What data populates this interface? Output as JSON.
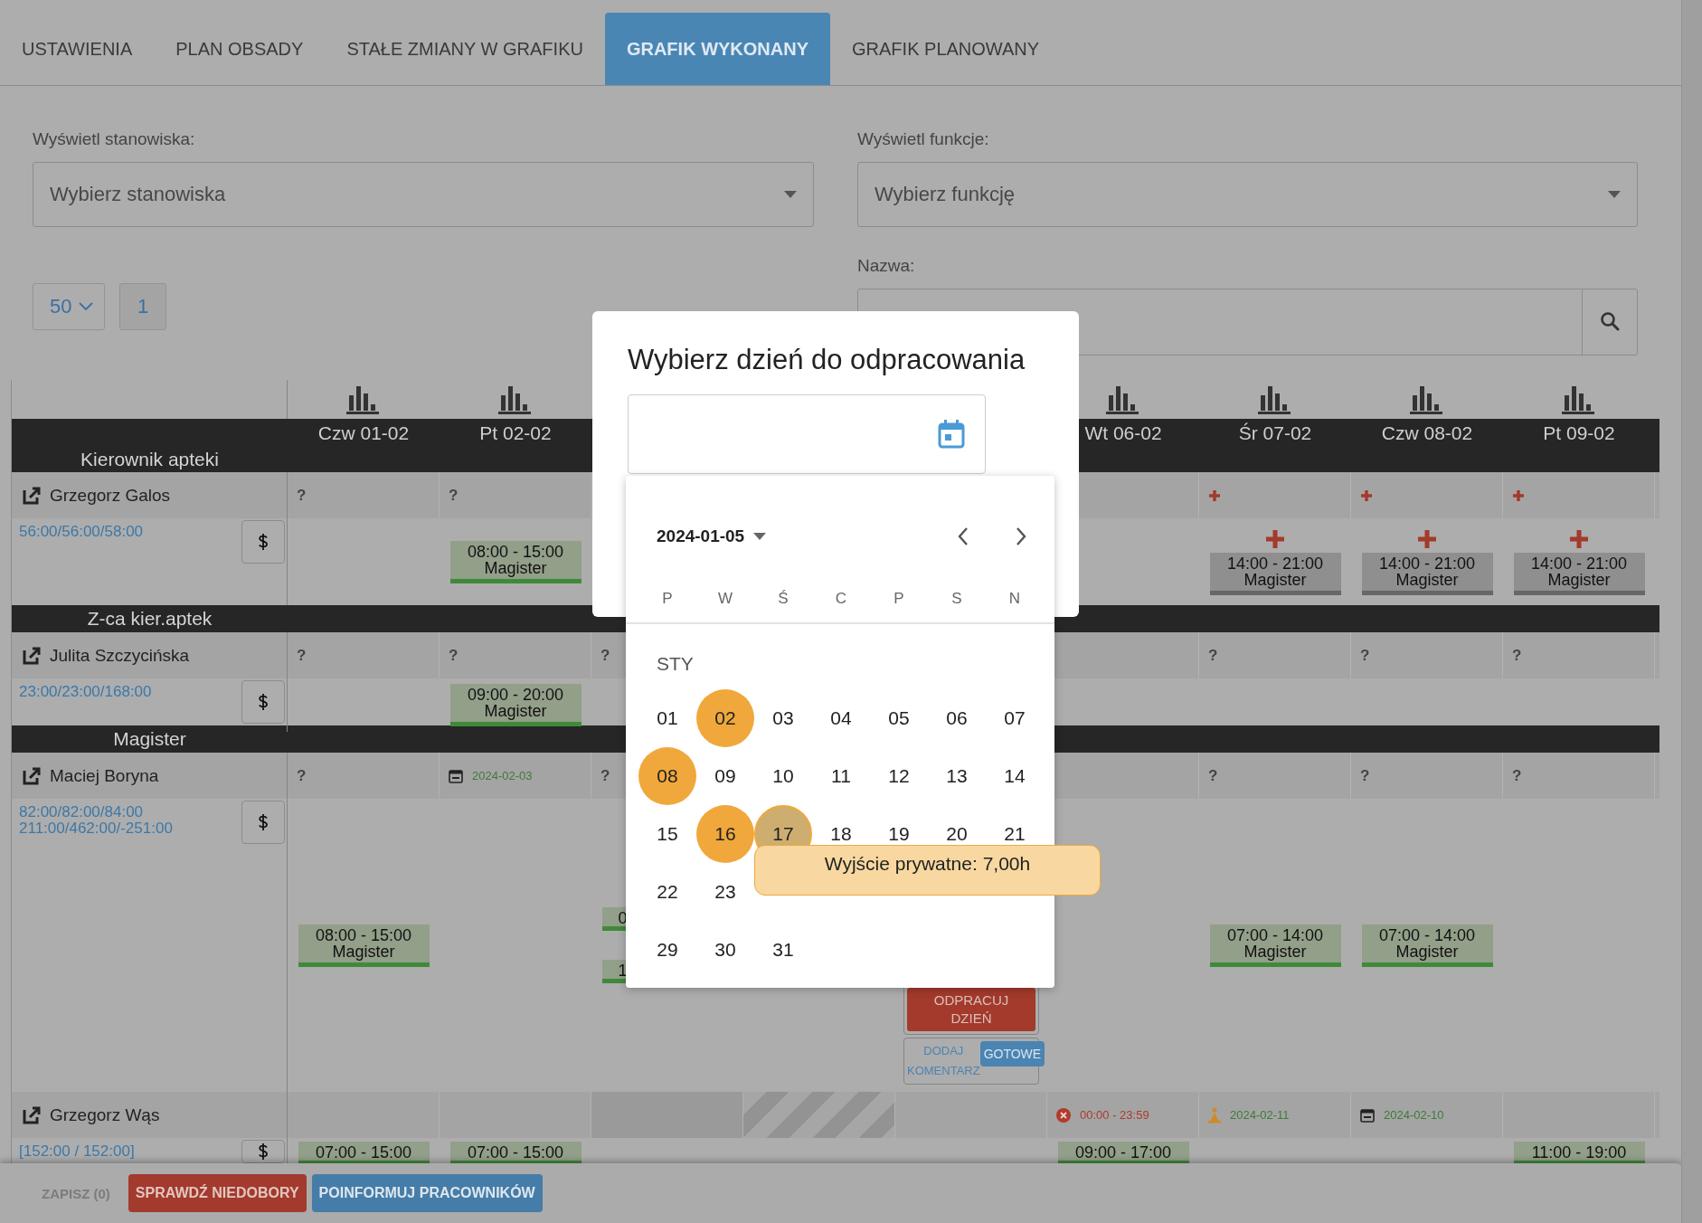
{
  "tabs": [
    {
      "label": "USTAWIENIA",
      "selected": false
    },
    {
      "label": "PLAN OBSADY",
      "selected": false
    },
    {
      "label": "STAŁE ZMIANY W GRAFIKU",
      "selected": false
    },
    {
      "label": "GRAFIK WYKONANY",
      "selected": true
    },
    {
      "label": "GRAFIK PLANOWANY",
      "selected": false
    }
  ],
  "filters": {
    "positions": {
      "label": "Wyświetl stanowiska:",
      "placeholder": "Wybierz stanowiska"
    },
    "functions": {
      "label": "Wyświetl funkcje:",
      "placeholder": "Wybierz funkcję"
    },
    "name": {
      "label": "Nazwa:"
    }
  },
  "page_size": "50",
  "pages": [
    "1"
  ],
  "days": [
    {
      "kind": "day",
      "label": "Czw 01-02"
    },
    {
      "kind": "day",
      "label": "Pt 02-02"
    },
    {
      "kind": "covered"
    },
    {
      "kind": "covered"
    },
    {
      "kind": "covered"
    },
    {
      "kind": "day",
      "label": "Wt 06-02"
    },
    {
      "kind": "day",
      "label": "Śr 07-02"
    },
    {
      "kind": "day",
      "label": "Czw 08-02"
    },
    {
      "kind": "day",
      "label": "Pt 09-02"
    }
  ],
  "groups": [
    {
      "name": "Kierownik apteki",
      "employees": [
        {
          "name": "Grzegorz Galos",
          "hours": [
            "56:00/56:00/58:00"
          ],
          "top": [
            {
              "kind": "note",
              "text": "?"
            },
            {
              "kind": "note",
              "text": "?"
            },
            {
              "kind": "empty"
            },
            {
              "kind": "empty"
            },
            {
              "kind": "empty"
            },
            {
              "kind": "empty"
            },
            {
              "kind": "add"
            },
            {
              "kind": "add"
            },
            {
              "kind": "add"
            }
          ],
          "body": [
            {
              "kind": "empty"
            },
            {
              "kind": "shifts",
              "add": false,
              "shifts": [
                {
                  "time": "08:00 - 15:00",
                  "role": "Magister",
                  "done": true,
                  "partial": false
                }
              ]
            },
            {
              "kind": "empty"
            },
            {
              "kind": "empty"
            },
            {
              "kind": "empty"
            },
            {
              "kind": "empty"
            },
            {
              "kind": "shifts",
              "add": true,
              "shifts": [
                {
                  "time": "14:00 - 21:00",
                  "role": "Magister",
                  "done": false,
                  "partial": false
                }
              ]
            },
            {
              "kind": "shifts",
              "add": true,
              "shifts": [
                {
                  "time": "14:00 - 21:00",
                  "role": "Magister",
                  "done": false,
                  "partial": false
                }
              ]
            },
            {
              "kind": "shifts",
              "add": true,
              "shifts": [
                {
                  "time": "14:00 - 21:00",
                  "role": "Magister",
                  "done": false,
                  "partial": false
                }
              ]
            }
          ]
        }
      ]
    },
    {
      "name": "Z-ca kier.aptek",
      "employees": [
        {
          "name": "Julita Szczycińska",
          "hours": [
            "23:00/23:00/168:00"
          ],
          "top": [
            {
              "kind": "note",
              "text": "?"
            },
            {
              "kind": "note",
              "text": "?"
            },
            {
              "kind": "note",
              "text": "?"
            },
            {
              "kind": "empty"
            },
            {
              "kind": "empty"
            },
            {
              "kind": "empty"
            },
            {
              "kind": "note",
              "text": "?"
            },
            {
              "kind": "note",
              "text": "?"
            },
            {
              "kind": "note",
              "text": "?"
            }
          ],
          "body": [
            {
              "kind": "empty"
            },
            {
              "kind": "shifts",
              "add": false,
              "shifts": [
                {
                  "time": "09:00 - 20:00",
                  "role": "Magister",
                  "done": true,
                  "partial": false
                }
              ]
            },
            {
              "kind": "empty"
            },
            {
              "kind": "empty"
            },
            {
              "kind": "empty"
            },
            {
              "kind": "empty"
            },
            {
              "kind": "empty"
            },
            {
              "kind": "empty"
            },
            {
              "kind": "empty"
            }
          ]
        }
      ]
    },
    {
      "name": "Magister",
      "employees": [
        {
          "name": "Maciej Boryna",
          "hours": [
            "82:00/82:00/84:00",
            "211:00/462:00/-251:00"
          ],
          "top": [
            {
              "kind": "note",
              "text": "?"
            },
            {
              "kind": "weekend",
              "text": "2024-02-03"
            },
            {
              "kind": "note",
              "text": "?"
            },
            {
              "kind": "empty"
            },
            {
              "kind": "empty"
            },
            {
              "kind": "empty"
            },
            {
              "kind": "note",
              "text": "?"
            },
            {
              "kind": "note",
              "text": "?"
            },
            {
              "kind": "note",
              "text": "?"
            }
          ],
          "body": [
            {
              "kind": "shifts",
              "add": false,
              "shifts": [
                {
                  "time": "08:00 - 15:00",
                  "role": "Magister",
                  "done": true,
                  "partial": false
                }
              ]
            },
            {
              "kind": "empty"
            },
            {
              "kind": "shifts",
              "add": false,
              "shifts": [
                {
                  "time": "0",
                  "done": true,
                  "partial": true
                },
                {
                  "time": "1",
                  "done": true,
                  "partial": true
                }
              ]
            },
            {
              "kind": "empty"
            },
            {
              "kind": "actions",
              "work_off": "ODPRACUJ DZIEŃ",
              "comment": "DODAJ KOMENTARZ",
              "done_label": "GOTOWE"
            },
            {
              "kind": "empty"
            },
            {
              "kind": "shifts",
              "add": false,
              "shifts": [
                {
                  "time": "07:00 - 14:00",
                  "role": "Magister",
                  "done": true,
                  "partial": false
                }
              ]
            },
            {
              "kind": "shifts",
              "add": false,
              "shifts": [
                {
                  "time": "07:00 - 14:00",
                  "role": "Magister",
                  "done": true,
                  "partial": false
                }
              ]
            },
            {
              "kind": "empty"
            }
          ]
        },
        {
          "name": "Grzegorz Wąs",
          "hours": [
            "[152:00 / 152:00]"
          ],
          "top": [
            {
              "kind": "empty"
            },
            {
              "kind": "empty"
            },
            {
              "kind": "blocked"
            },
            {
              "kind": "striped"
            },
            {
              "kind": "empty"
            },
            {
              "kind": "absence",
              "text": "00:00 - 23:59"
            },
            {
              "kind": "holiday",
              "text": "2024-02-11"
            },
            {
              "kind": "weekend",
              "text": "2024-02-10"
            },
            {
              "kind": "empty"
            }
          ],
          "body": [
            {
              "kind": "shifts",
              "add": false,
              "shifts": [
                {
                  "time": "07:00 - 15:00",
                  "done": true,
                  "partial": false
                }
              ]
            },
            {
              "kind": "shifts",
              "add": false,
              "shifts": [
                {
                  "time": "07:00 - 15:00",
                  "done": true,
                  "partial": false
                }
              ]
            },
            {
              "kind": "empty"
            },
            {
              "kind": "empty"
            },
            {
              "kind": "empty"
            },
            {
              "kind": "shifts",
              "add": false,
              "shifts": [
                {
                  "time": "09:00 - 17:00",
                  "done": true,
                  "partial": false
                }
              ]
            },
            {
              "kind": "empty"
            },
            {
              "kind": "empty"
            },
            {
              "kind": "shifts",
              "add": false,
              "shifts": [
                {
                  "time": "11:00 - 19:00",
                  "done": true,
                  "partial": false
                }
              ]
            }
          ]
        }
      ]
    }
  ],
  "bottom_bar": {
    "save": "ZAPISZ (0)",
    "check": "SPRAWDŹ NIEDOBORY",
    "inform": "POINFORMUJ PRACOWNIKÓW"
  },
  "modal": {
    "title": "Wybierz dzień do odpracowania",
    "datepicker": {
      "current": "2024-01-05",
      "weekdays": [
        "P",
        "W",
        "Ś",
        "C",
        "P",
        "S",
        "N"
      ],
      "month": "STY",
      "weeks": [
        [
          {
            "label": "01",
            "marked": false,
            "hovered": false
          },
          {
            "label": "02",
            "marked": true,
            "hovered": false
          },
          {
            "label": "03",
            "marked": false,
            "hovered": false
          },
          {
            "label": "04",
            "marked": false,
            "hovered": false
          },
          {
            "label": "05",
            "marked": false,
            "hovered": false
          },
          {
            "label": "06",
            "marked": false,
            "hovered": false
          },
          {
            "label": "07",
            "marked": false,
            "hovered": false
          }
        ],
        [
          {
            "label": "08",
            "marked": true,
            "hovered": false
          },
          {
            "label": "09",
            "marked": false,
            "hovered": false
          },
          {
            "label": "10",
            "marked": false,
            "hovered": false
          },
          {
            "label": "11",
            "marked": false,
            "hovered": false
          },
          {
            "label": "12",
            "marked": false,
            "hovered": false
          },
          {
            "label": "13",
            "marked": false,
            "hovered": false
          },
          {
            "label": "14",
            "marked": false,
            "hovered": false
          }
        ],
        [
          {
            "label": "15",
            "marked": false,
            "hovered": false
          },
          {
            "label": "16",
            "marked": true,
            "hovered": false
          },
          {
            "label": "17",
            "marked": false,
            "hovered": true
          },
          {
            "label": "18",
            "marked": false,
            "hovered": false
          },
          {
            "label": "19",
            "marked": false,
            "hovered": false
          },
          {
            "label": "20",
            "marked": false,
            "hovered": false
          },
          {
            "label": "21",
            "marked": false,
            "hovered": false
          }
        ],
        [
          {
            "label": "22",
            "marked": false,
            "hovered": false
          },
          {
            "label": "23",
            "marked": false,
            "hovered": false
          }
        ],
        [
          {
            "label": "29",
            "marked": false,
            "hovered": false
          },
          {
            "label": "30",
            "marked": false,
            "hovered": false
          },
          {
            "label": "31",
            "marked": false,
            "hovered": false
          }
        ]
      ],
      "tooltip": "Wyjście prywatne: 7,00h"
    }
  }
}
